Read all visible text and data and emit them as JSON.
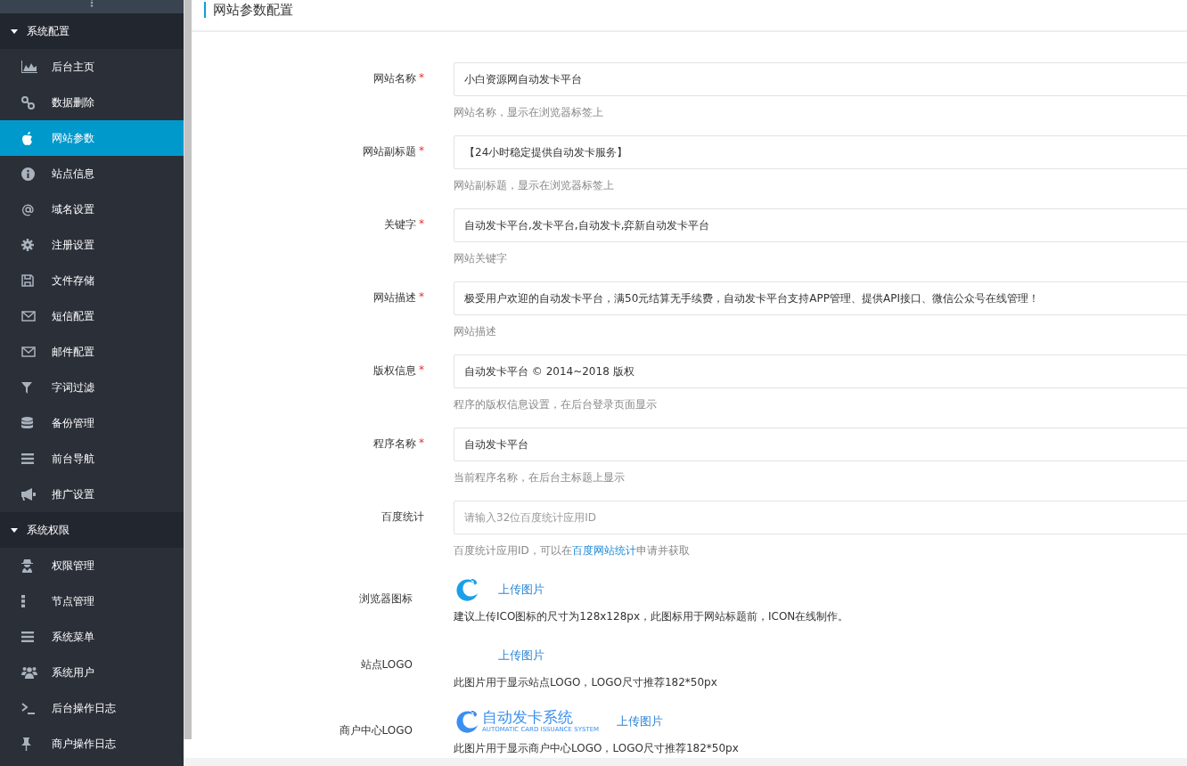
{
  "sidebar": {
    "groups": [
      {
        "title": "系统配置",
        "expanded": true,
        "items": [
          {
            "label": "后台主页",
            "selected": false
          },
          {
            "label": "数据删除",
            "selected": false
          },
          {
            "label": "网站参数",
            "selected": true
          },
          {
            "label": "站点信息",
            "selected": false
          },
          {
            "label": "域名设置",
            "selected": false
          },
          {
            "label": "注册设置",
            "selected": false
          },
          {
            "label": "文件存储",
            "selected": false
          },
          {
            "label": "短信配置",
            "selected": false
          },
          {
            "label": "邮件配置",
            "selected": false
          },
          {
            "label": "字词过滤",
            "selected": false
          },
          {
            "label": "备份管理",
            "selected": false
          },
          {
            "label": "前台导航",
            "selected": false
          },
          {
            "label": "推广设置",
            "selected": false
          }
        ]
      },
      {
        "title": "系统权限",
        "expanded": true,
        "items": [
          {
            "label": "权限管理",
            "selected": false
          },
          {
            "label": "节点管理",
            "selected": false
          },
          {
            "label": "系统菜单",
            "selected": false
          },
          {
            "label": "系统用户",
            "selected": false
          },
          {
            "label": "后台操作日志",
            "selected": false
          },
          {
            "label": "商户操作日志",
            "selected": false
          }
        ]
      }
    ]
  },
  "page": {
    "title": "网站参数配置"
  },
  "fields": [
    {
      "kind": "text",
      "label": "网站名称",
      "required_mark": "*",
      "value": "小白资源网自动发卡平台",
      "help": "网站名称，显示在浏览器标签上"
    },
    {
      "kind": "text",
      "label": "网站副标题",
      "required_mark": "*",
      "value": "【24小时稳定提供自动发卡服务】",
      "help": "网站副标题，显示在浏览器标签上"
    },
    {
      "kind": "text",
      "label": "关键字",
      "required_mark": "*",
      "value": "自动发卡平台,发卡平台,自动发卡,弈新自动发卡平台",
      "help": "网站关键字"
    },
    {
      "kind": "text",
      "label": "网站描述",
      "required_mark": "*",
      "value": "极受用户欢迎的自动发卡平台，满50元结算无手续费，自动发卡平台支持APP管理、提供API接口、微信公众号在线管理！",
      "help": "网站描述"
    },
    {
      "kind": "text",
      "label": "版权信息",
      "required_mark": "*",
      "value": "自动发卡平台 © 2014~2018 版权",
      "help": "程序的版权信息设置，在后台登录页面显示"
    },
    {
      "kind": "text",
      "label": "程序名称",
      "required_mark": "*",
      "value": "自动发卡平台",
      "help": "当前程序名称，在后台主标题上显示"
    },
    {
      "kind": "text",
      "label": "百度统计",
      "placeholder": "请输入32位百度统计应用ID",
      "help": "百度统计应用ID，可以在",
      "help_link": "百度网站统计",
      "help_after": "申请并获取"
    },
    {
      "kind": "favicon",
      "label": "浏览器图标",
      "button": "上传图片",
      "help": "建议上传ICO图标的尺寸为128x128px，此图标用于网站标题前，ICON在线制作。"
    },
    {
      "kind": "blank",
      "label": "站点LOGO",
      "button": "上传图片",
      "help": "此图片用于显示站点LOGO，LOGO尺寸推荐182*50px"
    },
    {
      "kind": "logo",
      "label": "商户中心LOGO",
      "logo_title": "自动发卡系统",
      "logo_subtitle": "AUTOMATIC CARD ISSUANCE SYSTEM",
      "button": "上传图片",
      "help": "此图片用于显示商户中心LOGO，LOGO尺寸推荐182*50px"
    }
  ]
}
